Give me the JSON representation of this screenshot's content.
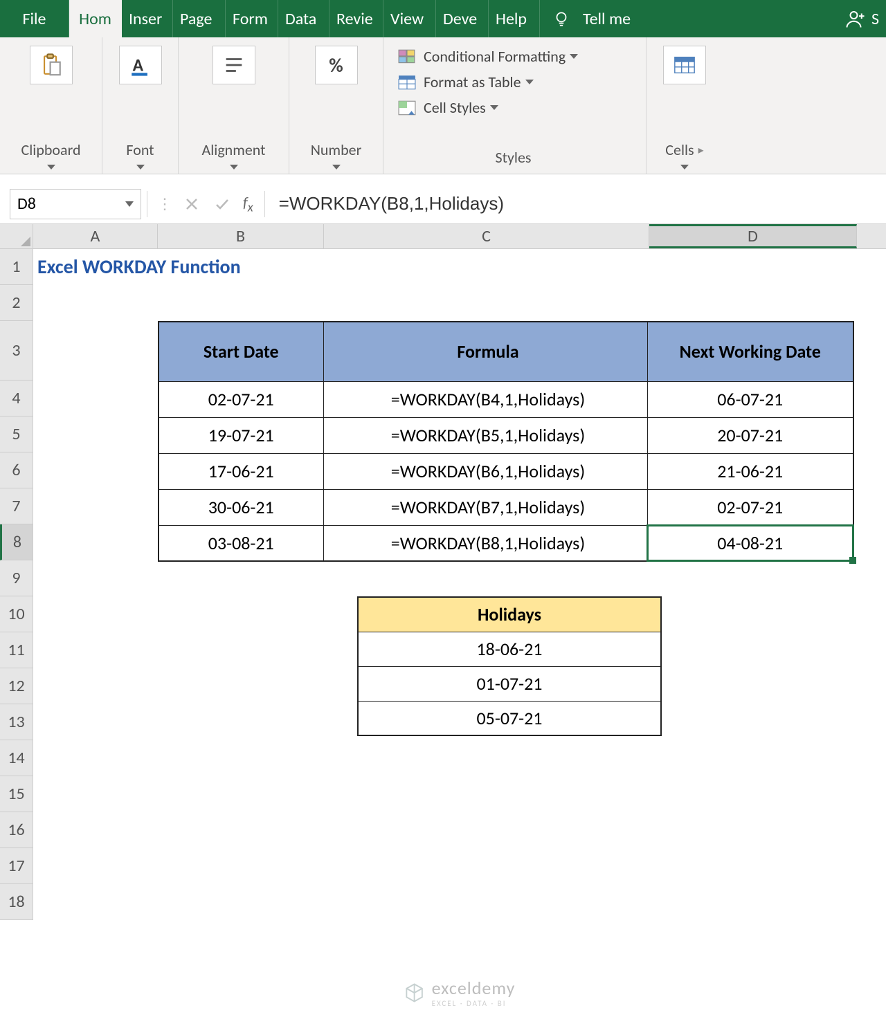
{
  "tabs": {
    "file": "File",
    "home": "Hom",
    "insert": "Inser",
    "page": "Page",
    "form": "Form",
    "data": "Data",
    "review": "Revie",
    "view": "View",
    "dev": "Deve",
    "help": "Help",
    "tellme": "Tell me",
    "share": "S"
  },
  "ribbon": {
    "clipboard": "Clipboard",
    "font": "Font",
    "alignment": "Alignment",
    "number": "Number",
    "styles_label": "Styles",
    "cond_fmt": "Conditional Formatting",
    "fmt_table": "Format as Table",
    "cell_styles": "Cell Styles",
    "cells": "Cells",
    "percent": "%"
  },
  "formula_bar": {
    "namebox": "D8",
    "formula": "=WORKDAY(B8,1,Holidays)"
  },
  "columns": {
    "A": "A",
    "B": "B",
    "C": "C",
    "D": "D"
  },
  "rows": [
    "1",
    "2",
    "3",
    "4",
    "5",
    "6",
    "7",
    "8",
    "9",
    "10",
    "11",
    "12",
    "13",
    "14",
    "15",
    "16",
    "17",
    "18"
  ],
  "sheet": {
    "title": "Excel WORKDAY Function",
    "headers": {
      "b": "Start Date",
      "c": "Formula",
      "d": "Next Working Date"
    },
    "data": [
      {
        "b": "02-07-21",
        "c": "=WORKDAY(B4,1,Holidays)",
        "d": "06-07-21"
      },
      {
        "b": "19-07-21",
        "c": "=WORKDAY(B5,1,Holidays)",
        "d": "20-07-21"
      },
      {
        "b": "17-06-21",
        "c": "=WORKDAY(B6,1,Holidays)",
        "d": "21-06-21"
      },
      {
        "b": "30-06-21",
        "c": "=WORKDAY(B7,1,Holidays)",
        "d": "02-07-21"
      },
      {
        "b": "03-08-21",
        "c": "=WORKDAY(B8,1,Holidays)",
        "d": "04-08-21"
      }
    ],
    "holidays_header": "Holidays",
    "holidays": [
      "18-06-21",
      "01-07-21",
      "05-07-21"
    ]
  },
  "watermark": {
    "main": "exceldemy",
    "sub": "EXCEL · DATA · BI"
  },
  "selected_cell": "D8",
  "selected_row": 8
}
